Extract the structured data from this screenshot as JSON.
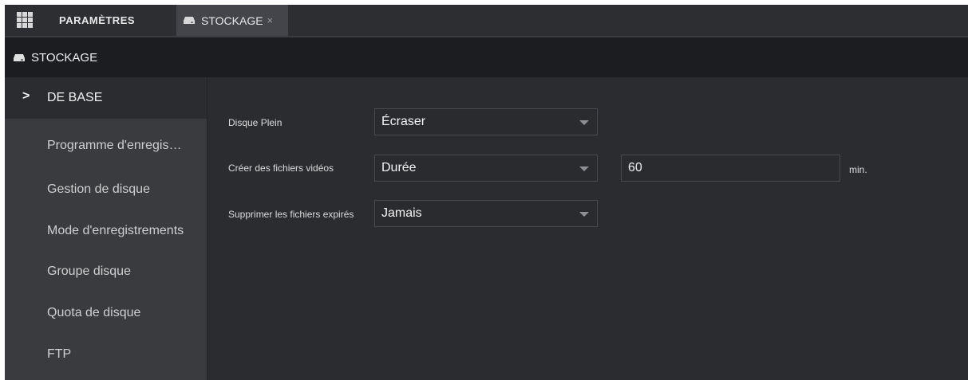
{
  "tabs": [
    {
      "label": "PARAMÈTRES"
    },
    {
      "label": "STOCKAGE",
      "close": "×"
    }
  ],
  "header": {
    "title": "STOCKAGE"
  },
  "sidebar": {
    "chevron": ">",
    "items": [
      {
        "label": "DE BASE",
        "active": true
      },
      {
        "label": "Programme d'enregis…"
      },
      {
        "label": "Gestion de disque"
      },
      {
        "label": "Mode d'enregistrements"
      },
      {
        "label": "Groupe disque"
      },
      {
        "label": "Quota de disque"
      },
      {
        "label": "FTP"
      }
    ]
  },
  "form": {
    "disk_full": {
      "label": "Disque Plein",
      "value": "Écraser"
    },
    "create_files": {
      "label": "Créer des fichiers vidéos",
      "value": "Durée",
      "duration": "60",
      "unit": "min."
    },
    "delete_expired": {
      "label": "Supprimer les fichiers expirés",
      "value": "Jamais"
    }
  },
  "colors": {
    "background": "#2b2c30",
    "sidebar": "#3a3b3f",
    "header": "#1c1d20",
    "active_tab": "#43454b"
  }
}
